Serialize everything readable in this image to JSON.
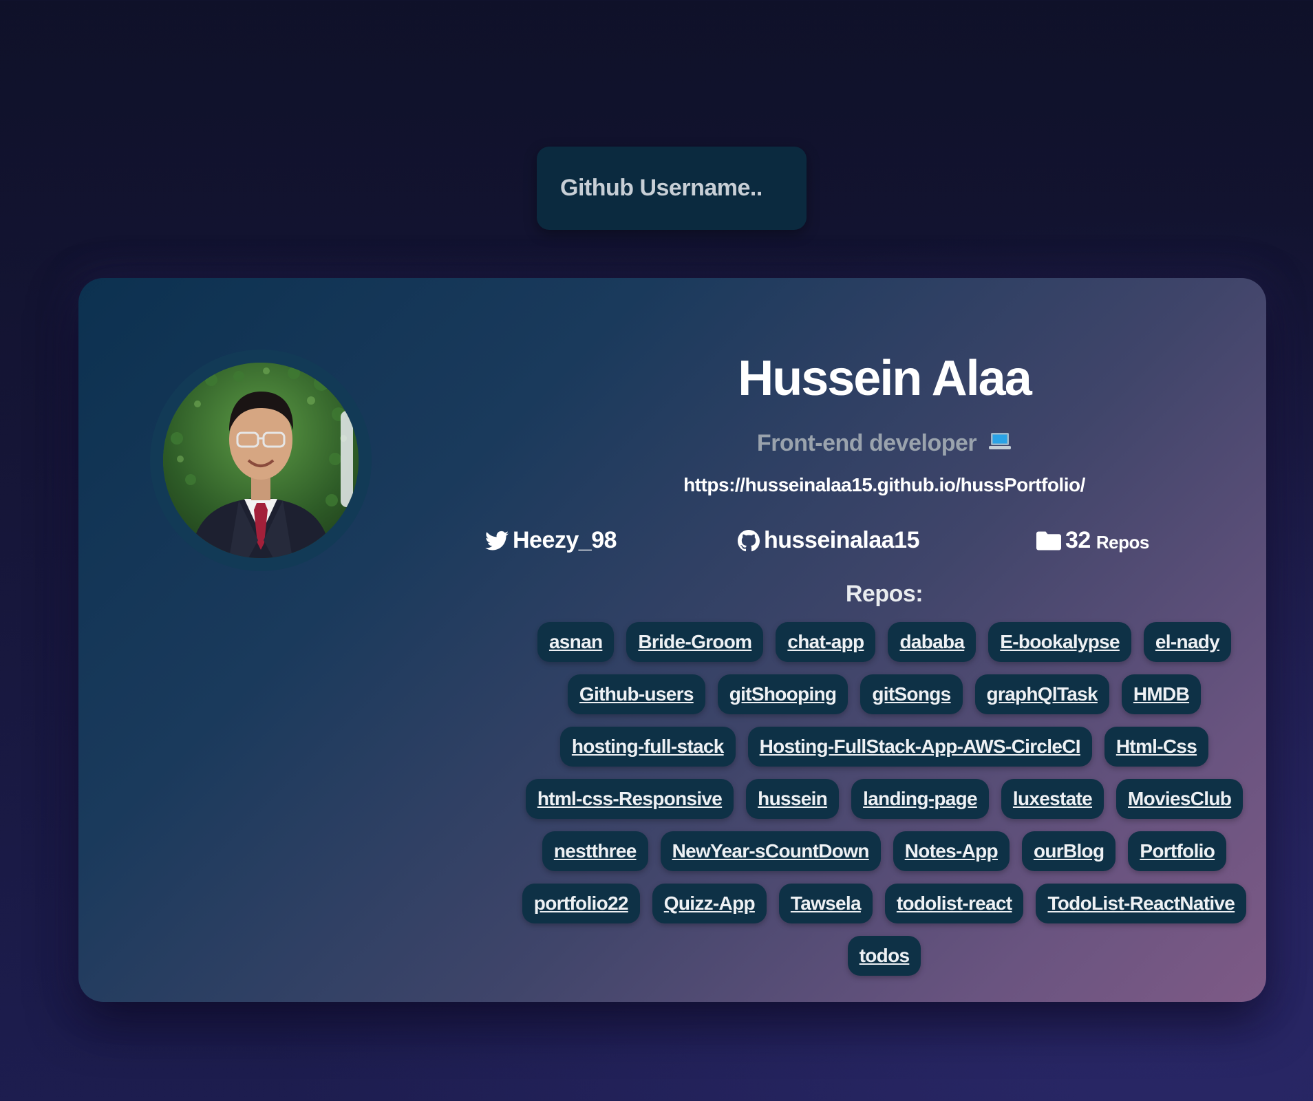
{
  "search": {
    "placeholder": "Github Username.."
  },
  "profile": {
    "name": "Hussein Alaa",
    "bio": "Front-end developer",
    "bio_icon": "laptop-icon",
    "blog": "https://husseinalaa15.github.io/hussPortfolio/",
    "twitter": "Heezy_98",
    "github_login": "husseinalaa15",
    "repo_count": "32",
    "repo_count_label": "Repos"
  },
  "repos": {
    "heading": "Repos:",
    "items": [
      "asnan",
      "Bride-Groom",
      "chat-app",
      "dababa",
      "E-bookalypse",
      "el-nady",
      "Github-users",
      "gitShooping",
      "gitSongs",
      "graphQlTask",
      "HMDB",
      "hosting-full-stack",
      "Hosting-FullStack-App-AWS-CircleCI",
      "Html-Css",
      "html-css-Responsive",
      "hussein",
      "landing-page",
      "luxestate",
      "MoviesClub",
      "nestthree",
      "NewYear-sCountDown",
      "Notes-App",
      "ourBlog",
      "Portfolio",
      "portfolio22",
      "Quizz-App",
      "Tawsela",
      "todolist-react",
      "TodoList-ReactNative",
      "todos"
    ]
  },
  "colors": {
    "page_bg": "#11132d",
    "input_bg": "#0b2a3f",
    "card_gradient_start": "#0c3150",
    "card_gradient_end": "#7e5a86",
    "tag_bg": "#0e3146",
    "bio_text": "#9aa3ad"
  }
}
